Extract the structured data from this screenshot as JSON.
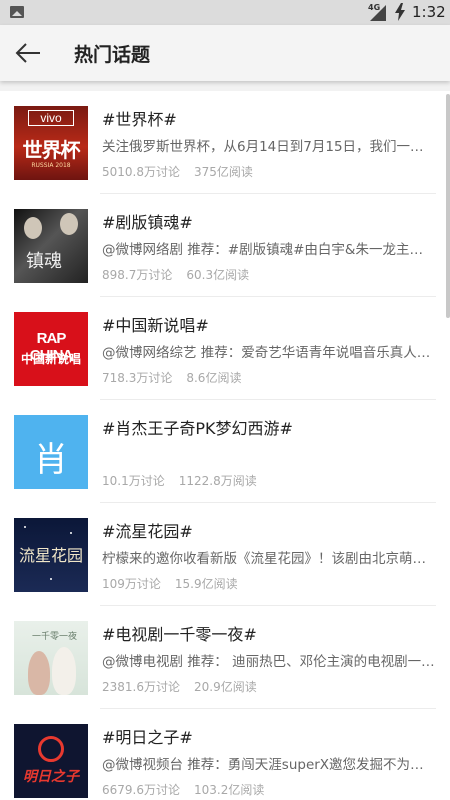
{
  "status_bar": {
    "network": "4G",
    "time": "1:32"
  },
  "header": {
    "title": "热门话题"
  },
  "thumbs": {
    "worldcup_brand": "vivo",
    "worldcup_text": "世界杯",
    "worldcup_sub": "RUSSIA 2018",
    "drama_text": "镇魂",
    "rap_en": "RAP CHINA",
    "rap_cn": "中国新说唱",
    "xiao_char": "肖",
    "meteor_text": "流星花园",
    "tv_text": "一千零一夜",
    "tomorrow_text": "明日之子"
  },
  "topics": [
    {
      "title": "#世界杯#",
      "desc": "关注俄罗斯世界杯，从6月14日到7月15日，我们一起看球吧",
      "discuss": "5010.8万讨论",
      "reads": "375亿阅读"
    },
    {
      "title": "#剧版镇魂#",
      "desc": "@微博网络剧 推荐：#剧版镇魂#由白宇&朱一龙主演，正在热播",
      "discuss": "898.7万讨论",
      "reads": "60.3亿阅读"
    },
    {
      "title": "#中国新说唱#",
      "desc": "@微博网络综艺 推荐：爱奇艺华语青年说唱音乐真人秀节目",
      "discuss": "718.3万讨论",
      "reads": "8.6亿阅读"
    },
    {
      "title": "#肖杰王子奇PK梦幻西游#",
      "desc": "",
      "discuss": "10.1万讨论",
      "reads": "1122.8万阅读"
    },
    {
      "title": "#流星花园#",
      "desc": "柠檬来的邀你收看新版《流星花园》！该剧由北京萌创出品",
      "discuss": "109万讨论",
      "reads": "15.9亿阅读"
    },
    {
      "title": "#电视剧一千零一夜#",
      "desc": "@微博电视剧 推荐： 迪丽热巴、邓伦主演的电视剧一千零一夜",
      "discuss": "2381.6万讨论",
      "reads": "20.9亿阅读"
    },
    {
      "title": "#明日之子#",
      "desc": "@微博视频台 推荐：勇闯天涯superX邀您发掘不为人知的音乐人",
      "discuss": "6679.6万讨论",
      "reads": "103.2亿阅读"
    }
  ]
}
